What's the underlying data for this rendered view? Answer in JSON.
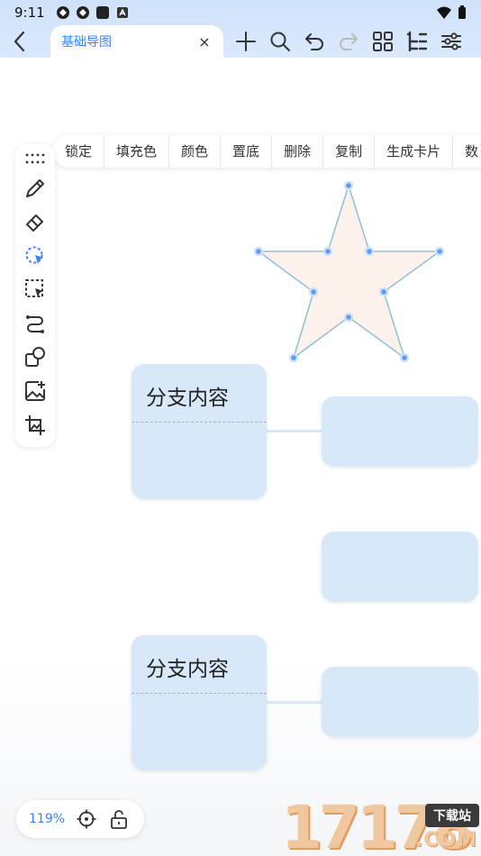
{
  "status_bar": {
    "time": "9:11"
  },
  "app_bar": {
    "tab_title": "基础导图",
    "close_glyph": "×"
  },
  "context_menu": {
    "items": [
      "锁定",
      "填充色",
      "颜色",
      "置底",
      "删除",
      "复制",
      "生成卡片",
      "数"
    ]
  },
  "nodes": {
    "branch_1_title": "分支内容",
    "branch_2_title": "分支内容"
  },
  "zoom": {
    "level": "119%"
  },
  "watermark": {
    "digits": "17178",
    "badge": "下载站",
    "domain": ".COM"
  },
  "colors": {
    "accent": "#3b82f6",
    "node_fill": "#d7e8f9",
    "star_fill": "#fdf1ec",
    "star_stroke": "#8fc3dc",
    "handle": "#5b9bf0"
  },
  "icons": {
    "back": "chevron-left-icon",
    "add": "plus-icon",
    "search": "search-icon",
    "undo": "undo-icon",
    "redo": "redo-icon",
    "grid": "grid-icon",
    "outline": "outline-icon",
    "settings": "sliders-icon",
    "drag": "drag-dots-icon",
    "pen": "pen-icon",
    "eraser": "eraser-icon",
    "lasso": "lasso-select-icon",
    "select": "box-select-icon",
    "connector": "connector-icon",
    "shape": "shape-icon",
    "add_image": "add-image-icon",
    "image_frame": "image-frame-icon",
    "locate": "locate-icon",
    "unlock": "unlock-icon"
  }
}
